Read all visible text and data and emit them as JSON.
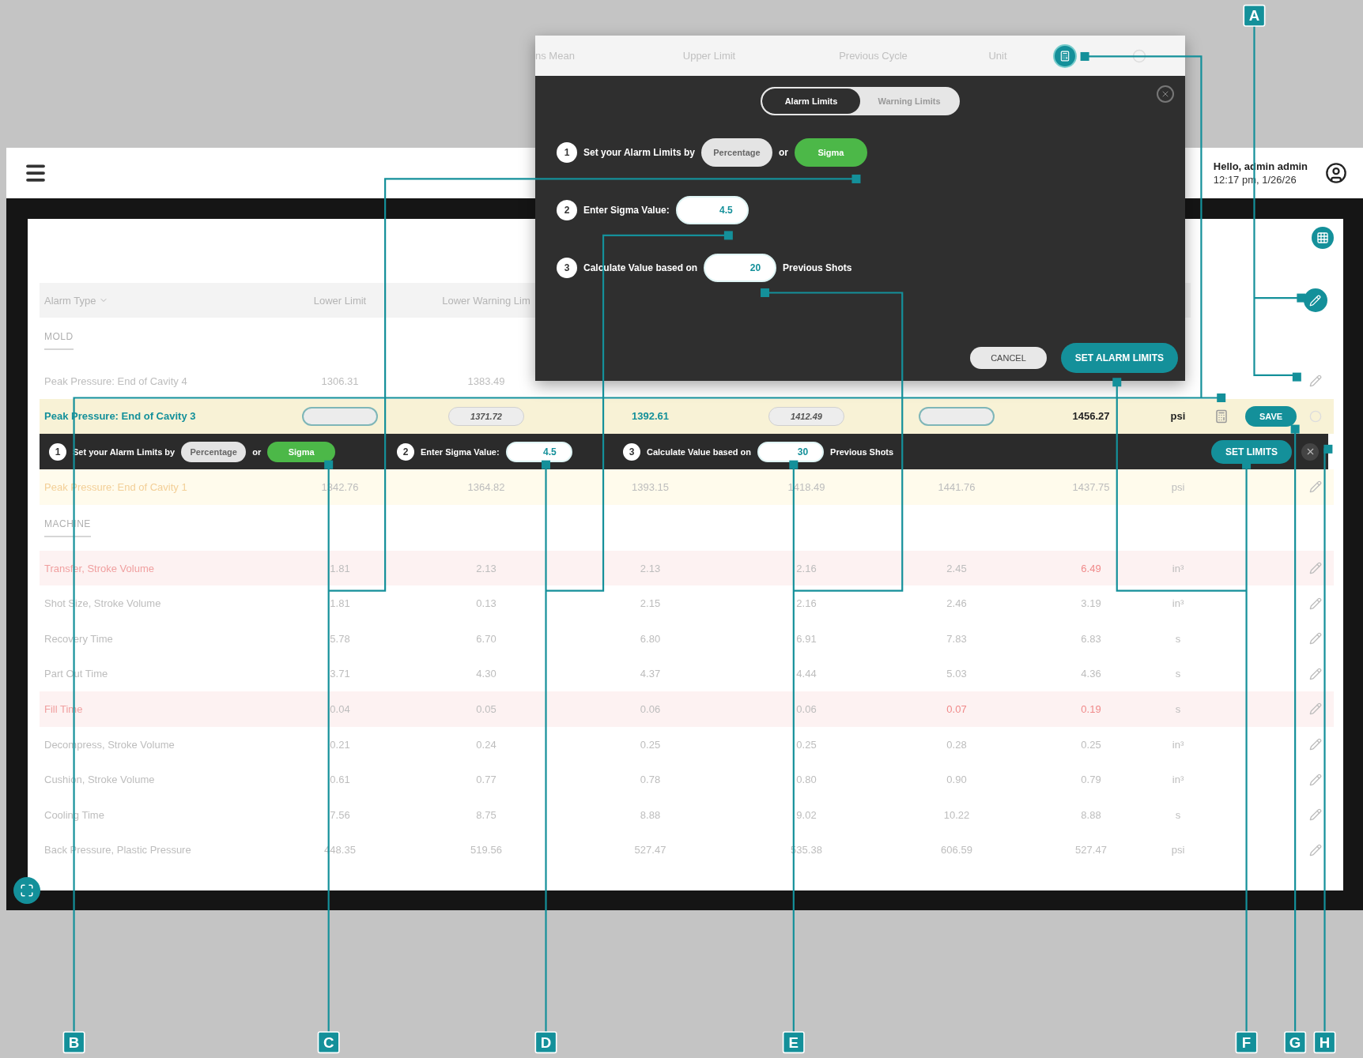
{
  "header": {
    "greeting": "Hello, admin admin",
    "timestamp": "12:17 pm, 1/26/26"
  },
  "table": {
    "columns": [
      "Alarm Type",
      "Lower Limit",
      "Lower Warning Lim"
    ],
    "sections": [
      {
        "title": "MOLD",
        "rows": [
          {
            "name": "Peak Pressure: End of Cavity 4",
            "kind": "plain",
            "alarm": false,
            "warning": false,
            "selected": false,
            "values": [
              "1306.31",
              "1383.49"
            ],
            "flagged": [
              false,
              false
            ]
          },
          {
            "name": "Peak Pressure: End of Cavity 3",
            "kind": "editing",
            "selected": true,
            "cells": [
              {
                "kind": "input"
              },
              {
                "kind": "pill",
                "text": "1371.72"
              },
              {
                "kind": "mean",
                "text": "1392.61"
              },
              {
                "kind": "pill",
                "text": "1412.49"
              },
              {
                "kind": "input"
              },
              {
                "kind": "bold",
                "text": "1456.27"
              }
            ],
            "unit": "psi"
          },
          {
            "name": "Peak Pressure: End of Cavity 1",
            "kind": "plain",
            "alarm": false,
            "warning": true,
            "selected": false,
            "values": [
              "1342.76",
              "1364.82",
              "1393.15",
              "1418.49",
              "1441.76",
              "1437.75"
            ],
            "flagged": [
              false,
              false,
              false,
              false,
              false,
              false
            ],
            "unit": "psi"
          }
        ]
      },
      {
        "title": "MACHINE",
        "rows": [
          {
            "name": "Transfer, Stroke Volume",
            "kind": "plain",
            "alarm": true,
            "warning": false,
            "selected": false,
            "values": [
              "1.81",
              "2.13",
              "2.13",
              "2.16",
              "2.45",
              "6.49"
            ],
            "flagged": [
              false,
              false,
              false,
              false,
              false,
              true
            ],
            "unit": "in³"
          },
          {
            "name": "Shot Size, Stroke Volume",
            "kind": "plain",
            "alarm": false,
            "warning": false,
            "selected": false,
            "values": [
              "1.81",
              "0.13",
              "2.15",
              "2.16",
              "2.46",
              "3.19"
            ],
            "flagged": [
              false,
              false,
              false,
              false,
              false,
              false
            ],
            "unit": "in³"
          },
          {
            "name": "Recovery Time",
            "kind": "plain",
            "alarm": false,
            "warning": false,
            "selected": false,
            "values": [
              "5.78",
              "6.70",
              "6.80",
              "6.91",
              "7.83",
              "6.83"
            ],
            "flagged": [
              false,
              false,
              false,
              false,
              false,
              false
            ],
            "unit": "s"
          },
          {
            "name": "Part Out Time",
            "kind": "plain",
            "alarm": false,
            "warning": false,
            "selected": false,
            "values": [
              "3.71",
              "4.30",
              "4.37",
              "4.44",
              "5.03",
              "4.36"
            ],
            "flagged": [
              false,
              false,
              false,
              false,
              false,
              false
            ],
            "unit": "s"
          },
          {
            "name": "Fill Time",
            "kind": "plain",
            "alarm": true,
            "warning": false,
            "selected": false,
            "values": [
              "0.04",
              "0.05",
              "0.06",
              "0.06",
              "0.07",
              "0.19"
            ],
            "flagged": [
              false,
              false,
              false,
              false,
              true,
              true
            ],
            "unit": "s"
          },
          {
            "name": "Decompress, Stroke Volume",
            "kind": "plain",
            "alarm": false,
            "warning": false,
            "selected": false,
            "values": [
              "0.21",
              "0.24",
              "0.25",
              "0.25",
              "0.28",
              "0.25"
            ],
            "flagged": [
              false,
              false,
              false,
              false,
              false,
              false
            ],
            "unit": "in³"
          },
          {
            "name": "Cushion, Stroke Volume",
            "kind": "plain",
            "alarm": false,
            "warning": false,
            "selected": false,
            "values": [
              "0.61",
              "0.77",
              "0.78",
              "0.80",
              "0.90",
              "0.79"
            ],
            "flagged": [
              false,
              false,
              false,
              false,
              false,
              false
            ],
            "unit": "in³"
          },
          {
            "name": "Cooling Time",
            "kind": "plain",
            "alarm": false,
            "warning": false,
            "selected": false,
            "values": [
              "7.56",
              "8.75",
              "8.88",
              "9.02",
              "10.22",
              "8.88"
            ],
            "flagged": [
              false,
              false,
              false,
              false,
              false,
              false
            ],
            "unit": "s"
          },
          {
            "name": "Back Pressure, Plastic Pressure",
            "kind": "plain",
            "alarm": false,
            "warning": false,
            "selected": false,
            "values": [
              "448.35",
              "519.56",
              "527.47",
              "535.38",
              "606.59",
              "527.47"
            ],
            "flagged": [
              false,
              false,
              false,
              false,
              false,
              false
            ],
            "unit": "psi"
          }
        ]
      }
    ]
  },
  "limit_bar": {
    "steps": [
      {
        "kind": "choice",
        "number": "1",
        "label": "Set your Alarm Limits by",
        "joiner": "or",
        "options": [
          {
            "label": "Percentage",
            "selected": false
          },
          {
            "label": "Sigma",
            "selected": true
          }
        ]
      },
      {
        "kind": "input",
        "number": "2",
        "label": "Enter Sigma Value:",
        "value": "4.5"
      },
      {
        "kind": "input",
        "number": "3",
        "label": "Calculate Value based on",
        "value": "30",
        "suffix": "Previous Shots"
      }
    ],
    "button": "SET LIMITS",
    "save": "SAVE"
  },
  "popup": {
    "columns": [
      "ns Mean",
      "Upper Limit",
      "Previous Cycle",
      "Unit"
    ],
    "tabs": [
      {
        "label": "Alarm Limits",
        "selected": true
      },
      {
        "label": "Warning Limits",
        "selected": false
      }
    ],
    "steps": [
      {
        "kind": "choice",
        "number": "1",
        "label": "Set your Alarm Limits by",
        "joiner": "or",
        "options": [
          {
            "label": "Percentage",
            "selected": false
          },
          {
            "label": "Sigma",
            "selected": true
          }
        ]
      },
      {
        "kind": "input",
        "number": "2",
        "label": "Enter Sigma Value:",
        "value": "4.5"
      },
      {
        "kind": "input",
        "number": "3",
        "label": "Calculate Value based on",
        "value": "20",
        "suffix": "Previous Shots"
      }
    ],
    "buttons": [
      {
        "label": "CANCEL",
        "kind": "secondary"
      },
      {
        "label": "SET ALARM LIMITS",
        "kind": "primary"
      }
    ]
  },
  "callouts": [
    "A",
    "B",
    "C",
    "D",
    "E",
    "F",
    "G",
    "H"
  ]
}
